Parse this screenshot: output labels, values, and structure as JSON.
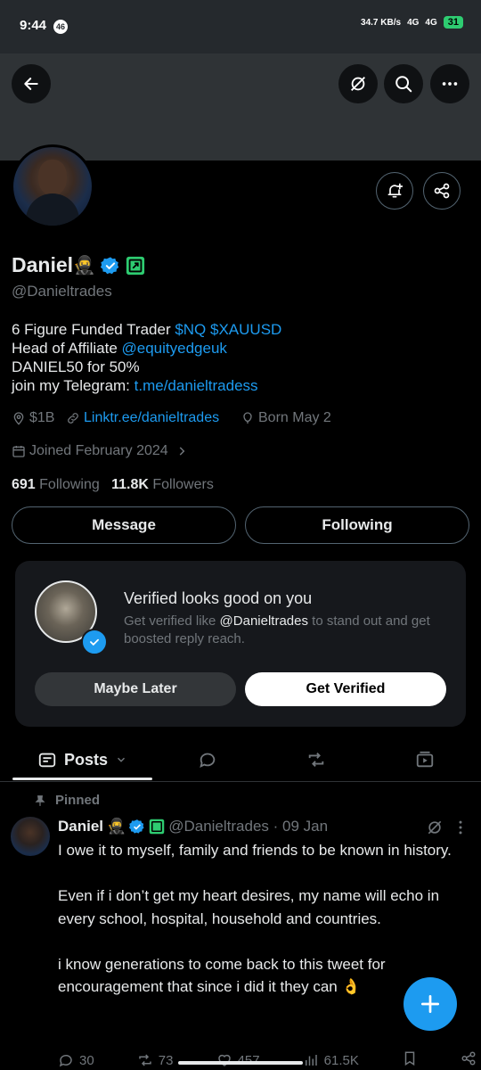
{
  "status_bar": {
    "time": "9:44",
    "notif_count": "46",
    "net_speed": "34.7 KB/s",
    "sig1": "4G",
    "sig2": "4G",
    "battery": "31"
  },
  "profile": {
    "name": "Daniel",
    "emoji": "🥷",
    "handle": "@Danieltrades",
    "bio": [
      {
        "text": "6 Figure Funded Trader ",
        "link": "$NQ $XAUUSD"
      },
      {
        "text": "Head of Affiliate ",
        "link": "@equityedgeuk"
      },
      {
        "text": "DANIEL50 for 50%",
        "link": ""
      },
      {
        "text": "join my Telegram: ",
        "link": "t.me/danieltradess"
      }
    ],
    "location": "$1B",
    "website": "Linktr.ee/danieltrades",
    "birthday": "Born May 2",
    "joined": "Joined February 2024",
    "following_count": "691",
    "following_label": "Following",
    "followers_count": "11.8K",
    "followers_label": "Followers"
  },
  "buttons": {
    "message": "Message",
    "following": "Following"
  },
  "verify_card": {
    "title": "Verified looks good on you",
    "sub_prefix": "Get verified like ",
    "sub_handle": "@Danieltrades",
    "sub_suffix": " to stand out and get boosted reply reach.",
    "maybe_later": "Maybe Later",
    "get_verified": "Get Verified"
  },
  "tabs": {
    "posts": "Posts"
  },
  "post": {
    "pinned_label": "Pinned",
    "name": "Daniel",
    "emoji": "🥷",
    "handle_date": "@Danieltrades · 09 Jan",
    "text": "I owe it to myself, family and friends to be known in history.\n\nEven if i don’t get my heart desires, my name will echo in every school, hospital, household and countries.\n\ni know generations to come back to this tweet for encouragement that since i did it they can 👌",
    "replies": "30",
    "reposts": "73",
    "likes": "457",
    "views": "61.5K"
  },
  "colors": {
    "accent": "#1d9bf0",
    "background": "#000000",
    "muted": "#71767b",
    "card": "#16181c",
    "affiliate_badge": "#2ecc71"
  }
}
